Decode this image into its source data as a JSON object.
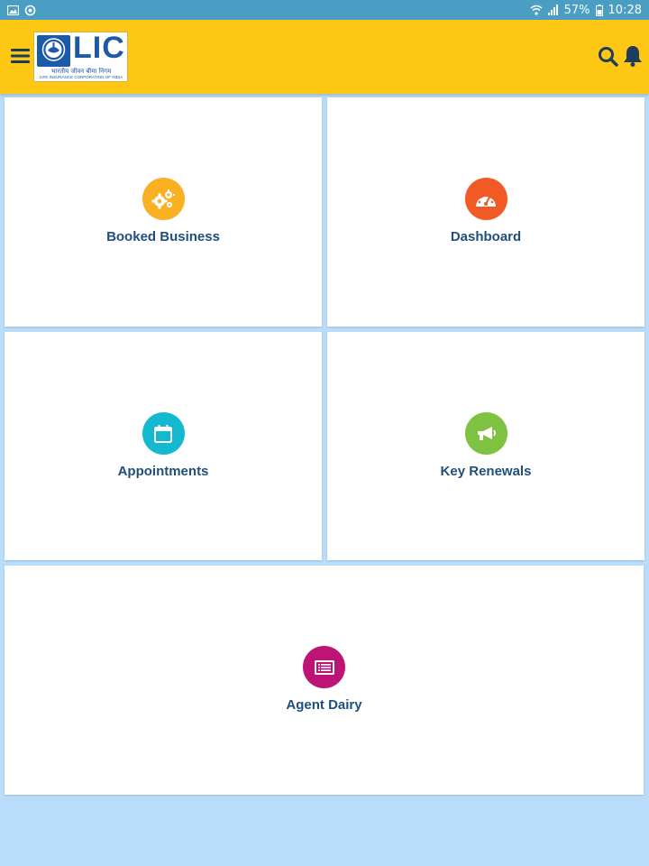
{
  "status_bar": {
    "battery": "57%",
    "time": "10:28"
  },
  "header": {
    "logo_text": "LIC",
    "logo_hindi": "भारतीय जीवन बीमा निगम",
    "logo_english": "LIFE INSURANCE CORPORATION OF INDIA",
    "background": "#fdc713"
  },
  "tiles": [
    {
      "label": "Booked Business",
      "icon": "gears-icon",
      "color": "#f9b022"
    },
    {
      "label": "Dashboard",
      "icon": "speedometer-icon",
      "color": "#f15a24"
    },
    {
      "label": "Appointments",
      "icon": "calendar-icon",
      "color": "#14b8cf"
    },
    {
      "label": "Key Renewals",
      "icon": "megaphone-icon",
      "color": "#7fc241"
    },
    {
      "label": "Agent Dairy",
      "icon": "diary-icon",
      "color": "#be1475"
    }
  ],
  "colors": {
    "page_background": "#b9dcfb",
    "status_bar": "#4a9ec4",
    "tile_label": "#1f4f7a",
    "icons": "#1d3d5c"
  }
}
